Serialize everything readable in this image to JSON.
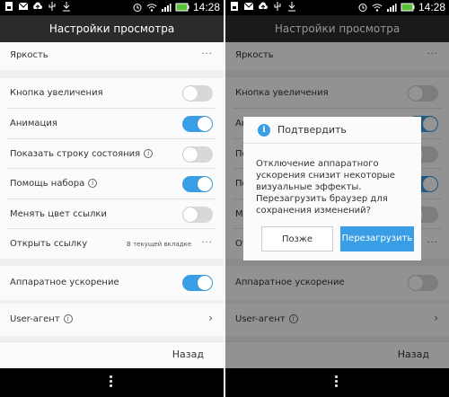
{
  "status": {
    "time": "14:28",
    "icons_left": [
      "sim-icon",
      "mail-icon",
      "cloud-upload-icon",
      "usb-icon",
      "download-icon"
    ],
    "icons_right": [
      "alarm-icon",
      "wifi-icon",
      "signal-icon",
      "battery-icon"
    ]
  },
  "title": "Настройки просмотра",
  "settings": {
    "brightness": "Яркость",
    "zoom_button": "Кнопка увеличения",
    "animation": "Анимация",
    "show_status": "Показать строку состояния",
    "typing_help": "Помощь набора",
    "link_color": "Менять цвет ссылки",
    "open_link": "Открыть ссылку",
    "open_link_value": "В текущей вкладке",
    "hw_accel": "Аппаратное ускорение",
    "user_agent": "User-агент",
    "dots": "···",
    "chevron": "›",
    "info_glyph": "i"
  },
  "toggles": {
    "zoom_button": false,
    "animation": true,
    "show_status": false,
    "typing_help": true,
    "link_color": false,
    "hw_accel": true
  },
  "toggles_right": {
    "hw_accel": false
  },
  "footer": {
    "back": "Назад"
  },
  "dialog": {
    "title": "Подтвердить",
    "message": "Отключение аппаратного ускорения снизит некоторые визуальные эффекты. Перезагрузить браузер для сохранения изменений?",
    "cancel": "Позже",
    "confirm": "Перезагрузить",
    "info_glyph": "i"
  },
  "colors": {
    "accent": "#3a9ee6",
    "titlebar": "#2b2b2b",
    "toggle_off": "#d8d8d8"
  }
}
